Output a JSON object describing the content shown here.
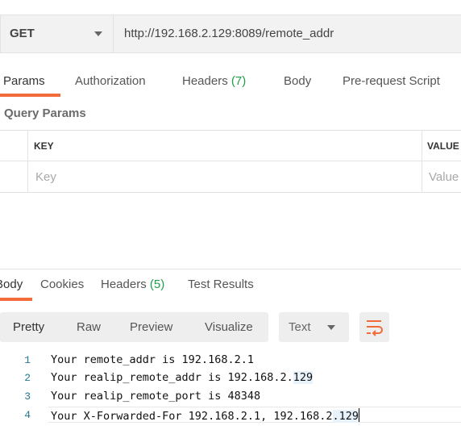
{
  "request": {
    "method": "GET",
    "url": "http://192.168.2.129:8089/remote_addr"
  },
  "request_tabs": [
    {
      "label": "Params",
      "count": null
    },
    {
      "label": "Authorization",
      "count": null
    },
    {
      "label": "Headers",
      "count": "(7)"
    },
    {
      "label": "Body",
      "count": null
    },
    {
      "label": "Pre-request Script",
      "count": null
    }
  ],
  "query_params": {
    "title": "Query Params",
    "columns": [
      "KEY",
      "VALUE"
    ],
    "key_placeholder": "Key",
    "value_placeholder": "Value"
  },
  "response_tabs": [
    {
      "label": "Body",
      "count": null
    },
    {
      "label": "Cookies",
      "count": null
    },
    {
      "label": "Headers",
      "count": "(5)"
    },
    {
      "label": "Test Results",
      "count": null
    }
  ],
  "response_toolbar": {
    "formats": [
      "Pretty",
      "Raw",
      "Preview",
      "Visualize"
    ],
    "type_select": "Text",
    "wrap_icon": "wrap-lines-icon"
  },
  "response_body": {
    "lines": [
      {
        "number": "1",
        "text": "Your remote_addr is 192.168.2.1"
      },
      {
        "number": "2",
        "text_pre": "Your realip_remote_addr is 192.168.2.",
        "text_hl": "129"
      },
      {
        "number": "3",
        "text": "Your realip_remote_port is 48348"
      },
      {
        "number": "4",
        "text_pre": "Your X-Forwarded-For 192.168.2.1, 192.168.2",
        "text_hl": ".129"
      }
    ]
  },
  "colors": {
    "accent": "#f26b3a",
    "count": "#1d9e4a",
    "line_number": "#237893"
  }
}
